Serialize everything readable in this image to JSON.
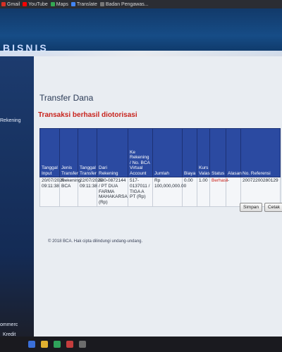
{
  "bookmarks": [
    {
      "label": "Gmail",
      "icon": "gmail-icon",
      "color": "#d93025"
    },
    {
      "label": "YouTube",
      "icon": "youtube-icon",
      "color": "#ff0000"
    },
    {
      "label": "Maps",
      "icon": "maps-icon",
      "color": "#34a853"
    },
    {
      "label": "Translate",
      "icon": "translate-icon",
      "color": "#4285f4"
    },
    {
      "label": "Badan Pengawas...",
      "icon": "bookmark-icon",
      "color": "#777777"
    }
  ],
  "header": {
    "brand": "BISNIS"
  },
  "sidebar": {
    "items": [
      "Rekening",
      "ommerc",
      "Kredit"
    ]
  },
  "main": {
    "title": "Transfer Dana",
    "message": "Transaksi berhasil diotorisasi",
    "table": {
      "headers": [
        "Tanggal Input",
        "Jenis Transfer",
        "Tanggal Transfer",
        "Dari Rekening",
        "Ke Rekening / No. BCA Virtual Account",
        "Jumlah",
        "Biaya",
        "Kurs Valas",
        "Status",
        "Alasan",
        "No. Referensi"
      ],
      "rows": [
        [
          "20/07/2020 09:11:38",
          "Rekening BCA",
          "22/07/2020 09:11:38",
          "680-0872144 / PT DUA FARMA MAHAKARSA (Rp)",
          "517-0137011 / TIGA A PT (Rp)",
          "Rp 100,000,000.00",
          "0.00",
          "1.00",
          "Berhasil",
          "-",
          "20072200280129"
        ]
      ]
    },
    "buttons": {
      "save": "Simpan",
      "print": "Cetak"
    },
    "copyright": "© 2018 BCA. Hak cipta dilindungi undang-undang."
  },
  "colors": {
    "accent": "#2b4aa1",
    "error": "#c8221b",
    "header": "#164c86"
  }
}
